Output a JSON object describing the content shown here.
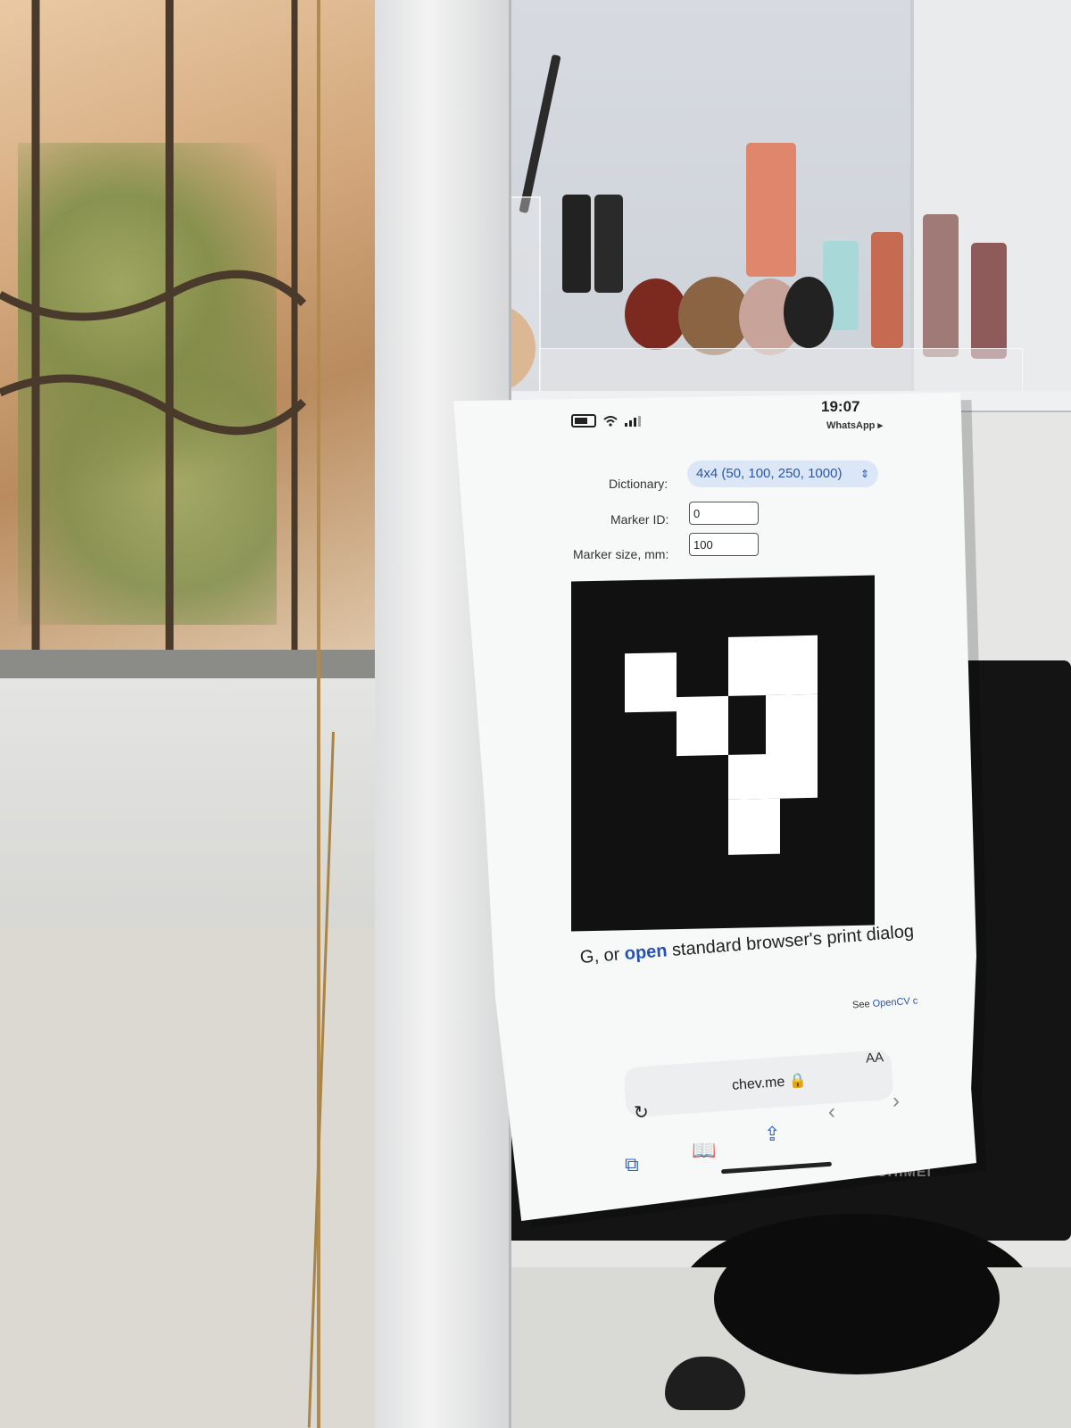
{
  "phone_screen": {
    "status_bar": {
      "time": "19:07",
      "back_app": "WhatsApp ▸"
    },
    "form": {
      "dictionary_label": "Dictionary:",
      "dictionary_value": "4x4 (50, 100, 250, 1000)",
      "marker_id_label": "Marker ID:",
      "marker_id_value": "0",
      "marker_size_label": "Marker size, mm:",
      "marker_size_value": "100"
    },
    "instruction": {
      "prefix": "G, or ",
      "link": "open",
      "suffix": " standard browser's print dialog"
    },
    "see_link": {
      "prefix": "See ",
      "link": "OpenCV c"
    },
    "browser": {
      "aa": "AA",
      "url": "chev.me 🔒"
    }
  },
  "monitor": {
    "brand": "CHIMEI"
  },
  "colors": {
    "link": "#2652b8",
    "select_bg": "#dbe7f7"
  }
}
